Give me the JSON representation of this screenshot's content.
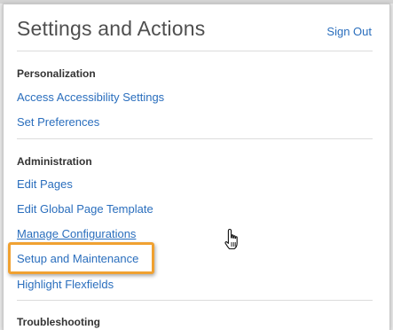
{
  "header": {
    "title": "Settings and Actions",
    "sign_out_label": "Sign Out"
  },
  "sections": [
    {
      "heading": "Personalization",
      "items": [
        {
          "label": "Access Accessibility Settings"
        },
        {
          "label": "Set Preferences"
        }
      ]
    },
    {
      "heading": "Administration",
      "items": [
        {
          "label": "Edit Pages"
        },
        {
          "label": "Edit Global Page Template"
        },
        {
          "label": "Manage Configurations"
        },
        {
          "label": "Setup and Maintenance"
        },
        {
          "label": "Highlight Flexfields"
        }
      ]
    },
    {
      "heading": "Troubleshooting",
      "items": []
    }
  ],
  "colors": {
    "link": "#2a6ebd",
    "highlight_border": "#f0a131",
    "title": "#4f4f4f"
  },
  "icons": {
    "cursor": "hand-pointer-icon"
  }
}
